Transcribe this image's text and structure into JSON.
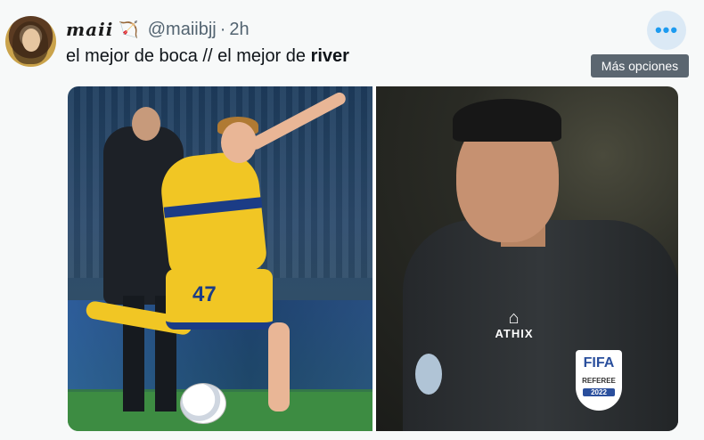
{
  "post": {
    "display_name": "maii",
    "name_emoji": "🏹",
    "handle": "@maiibjj",
    "separator": "·",
    "timestamp": "2h",
    "text_part1": "el mejor de boca // el mejor de ",
    "text_bold": "river"
  },
  "more_options": {
    "icon": "more-horizontal-icon",
    "glyph": "•••",
    "tooltip": "Más opciones"
  },
  "media": {
    "left_photo": {
      "player_number": "47"
    },
    "right_photo": {
      "sponsor_logo": "ATHIX",
      "badge_title": "FIFA",
      "badge_subtitle": "REFEREE",
      "badge_year": "2022"
    }
  },
  "colors": {
    "accent": "#1d9bf0",
    "tooltip_bg": "#5b6670",
    "secondary_text": "#536471"
  }
}
